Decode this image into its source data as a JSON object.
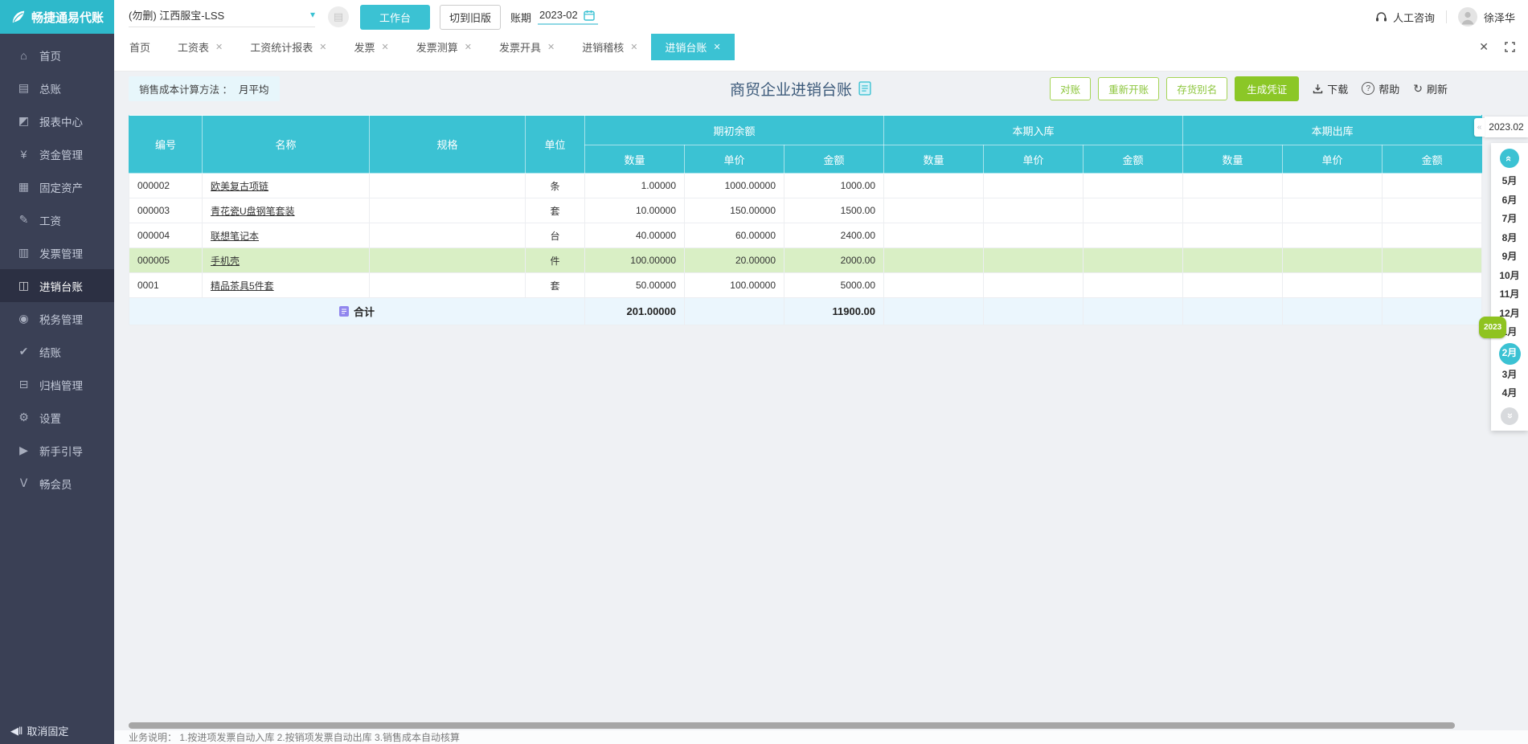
{
  "topbar": {
    "logo_text": "畅捷通易代账",
    "account": "(勿删) 江西服宝-LSS",
    "workbench_btn": "工作台",
    "switch_old_btn": "切到旧版",
    "period_label": "账期",
    "period_value": "2023-02",
    "support_label": "人工咨询",
    "username": "徐泽华"
  },
  "sidebar": {
    "unpin_icon": "◀‖",
    "unpin_label": "取消固定",
    "items": [
      {
        "key": "home",
        "label": "首页",
        "icon": "home-icon",
        "glyph": "⌂",
        "selected": false
      },
      {
        "key": "general-ledger",
        "label": "总账",
        "icon": "ledger-icon",
        "glyph": "▤",
        "selected": false
      },
      {
        "key": "report-center",
        "label": "报表中心",
        "icon": "chart-icon",
        "glyph": "◩",
        "selected": false
      },
      {
        "key": "funds",
        "label": "资金管理",
        "icon": "money-bag-icon",
        "glyph": "¥",
        "selected": false
      },
      {
        "key": "fixed-assets",
        "label": "固定资产",
        "icon": "building-icon",
        "glyph": "▦",
        "selected": false
      },
      {
        "key": "payroll",
        "label": "工资",
        "icon": "payroll-icon",
        "glyph": "✎",
        "selected": false
      },
      {
        "key": "invoice",
        "label": "发票管理",
        "icon": "invoice-icon",
        "glyph": "▥",
        "selected": false
      },
      {
        "key": "purchase-sale-ledger",
        "label": "进销台账",
        "icon": "inout-ledger-icon",
        "glyph": "◫",
        "selected": true
      },
      {
        "key": "tax",
        "label": "税务管理",
        "icon": "tax-icon",
        "glyph": "◉",
        "selected": false
      },
      {
        "key": "closing",
        "label": "结账",
        "icon": "closing-icon",
        "glyph": "✔",
        "selected": false
      },
      {
        "key": "archive",
        "label": "归档管理",
        "icon": "archive-icon",
        "glyph": "⊟",
        "selected": false
      },
      {
        "key": "settings",
        "label": "设置",
        "icon": "gear-icon",
        "glyph": "⚙",
        "selected": false
      },
      {
        "key": "guide",
        "label": "新手引导",
        "icon": "video-icon",
        "glyph": "▶",
        "selected": false
      },
      {
        "key": "member",
        "label": "畅会员",
        "icon": "member-icon",
        "glyph": "Ⅴ",
        "selected": false
      }
    ]
  },
  "tabs": {
    "items": [
      {
        "key": "home",
        "label": "首页",
        "closable": false,
        "active": false
      },
      {
        "key": "payroll-sheet",
        "label": "工资表",
        "closable": true,
        "active": false
      },
      {
        "key": "payroll-report",
        "label": "工资统计报表",
        "closable": true,
        "active": false
      },
      {
        "key": "invoice",
        "label": "发票",
        "closable": true,
        "active": false
      },
      {
        "key": "invoice-calc",
        "label": "发票测算",
        "closable": true,
        "active": false
      },
      {
        "key": "invoice-issue",
        "label": "发票开具",
        "closable": true,
        "active": false
      },
      {
        "key": "inout-audit",
        "label": "进销稽核",
        "closable": true,
        "active": false
      },
      {
        "key": "inout-ledger",
        "label": "进销台账",
        "closable": true,
        "active": true
      }
    ],
    "close_all_icon": "✕"
  },
  "toolbar": {
    "method_label": "销售成本计算方法 ：",
    "method_value": "月平均",
    "title": "商贸企业进销台账",
    "check_btn": "对账",
    "reopen_btn": "重新开账",
    "alias_btn": "存货别名",
    "voucher_btn": "生成凭证",
    "download_btn": "下载",
    "help_btn": "帮助",
    "refresh_btn": "刷新"
  },
  "table": {
    "columns": [
      "编号",
      "名称",
      "规格",
      "单位"
    ],
    "groups": [
      "期初余额",
      "本期入库",
      "本期出库"
    ],
    "subcolumns": [
      "数量",
      "单价",
      "金额"
    ],
    "rows": [
      {
        "code": "000002",
        "name": "欧美复古项链",
        "spec": "",
        "unit": "条",
        "opening": [
          "1.00000",
          "1000.00000",
          "1000.00"
        ],
        "inbound": [
          "",
          "",
          ""
        ],
        "outbound": [
          "",
          "",
          ""
        ],
        "highlight": false
      },
      {
        "code": "000003",
        "name": "青花瓷U盘钢笔套装",
        "spec": "",
        "unit": "套",
        "opening": [
          "10.00000",
          "150.00000",
          "1500.00"
        ],
        "inbound": [
          "",
          "",
          ""
        ],
        "outbound": [
          "",
          "",
          ""
        ],
        "highlight": false
      },
      {
        "code": "000004",
        "name": "联想笔记本",
        "spec": "",
        "unit": "台",
        "opening": [
          "40.00000",
          "60.00000",
          "2400.00"
        ],
        "inbound": [
          "",
          "",
          ""
        ],
        "outbound": [
          "",
          "",
          ""
        ],
        "highlight": false
      },
      {
        "code": "000005",
        "name": "手机壳",
        "spec": "",
        "unit": "件",
        "opening": [
          "100.00000",
          "20.00000",
          "2000.00"
        ],
        "inbound": [
          "",
          "",
          ""
        ],
        "outbound": [
          "",
          "",
          ""
        ],
        "highlight": true
      },
      {
        "code": "0001",
        "name": "精品茶具5件套",
        "spec": "",
        "unit": "套",
        "opening": [
          "50.00000",
          "100.00000",
          "5000.00"
        ],
        "inbound": [
          "",
          "",
          ""
        ],
        "outbound": [
          "",
          "",
          ""
        ],
        "highlight": false
      }
    ],
    "total": {
      "label": "合计",
      "opening_qty": "201.00000",
      "opening_amount": "11900.00"
    }
  },
  "month_panel": {
    "period": "2023.02",
    "collapse_icon": "«",
    "nav_icon": "«",
    "items": [
      {
        "label": "5月",
        "selected": false,
        "badge": ""
      },
      {
        "label": "6月",
        "selected": false,
        "badge": ""
      },
      {
        "label": "7月",
        "selected": false,
        "badge": ""
      },
      {
        "label": "8月",
        "selected": false,
        "badge": ""
      },
      {
        "label": "9月",
        "selected": false,
        "badge": ""
      },
      {
        "label": "10月",
        "selected": false,
        "badge": ""
      },
      {
        "label": "11月",
        "selected": false,
        "badge": ""
      },
      {
        "label": "12月",
        "selected": false,
        "badge": ""
      },
      {
        "label": "1月",
        "selected": false,
        "badge": "2023"
      },
      {
        "label": "2月",
        "selected": true,
        "badge": ""
      },
      {
        "label": "3月",
        "selected": false,
        "badge": ""
      },
      {
        "label": "4月",
        "selected": false,
        "badge": ""
      }
    ]
  },
  "footer": {
    "note": "业务说明：  1.按进项发票自动入库   2.按销项发票自动出库   3.销售成本自动核算"
  }
}
